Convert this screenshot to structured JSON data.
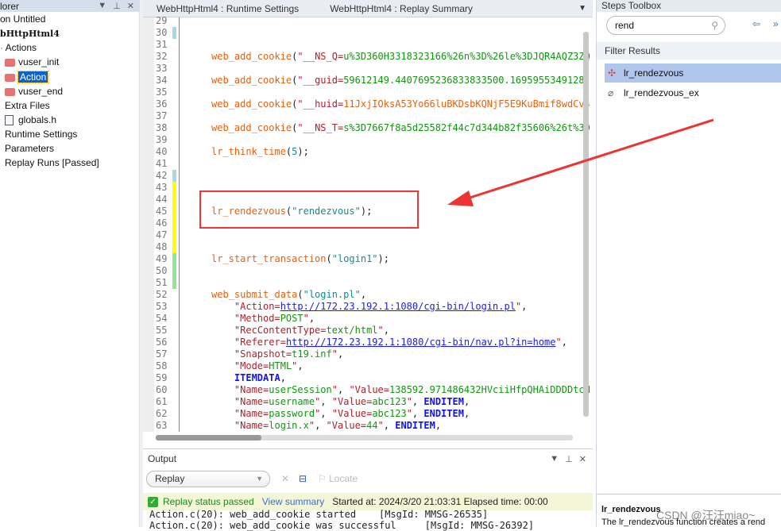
{
  "explorer": {
    "title": "lorer",
    "items": [
      "on Untitled",
      "bHttpHtml4",
      "Actions",
      "vuser_init",
      "Action",
      "vuser_end",
      "Extra Files",
      "globals.h",
      "Runtime Settings",
      "Parameters",
      "Replay Runs [Passed]"
    ]
  },
  "editor": {
    "tabs": [
      "WebHttpHtml4 : Runtime Settings",
      "WebHttpHtml4 : Replay Summary"
    ],
    "markers": {
      "30": "#a8d8e6",
      "42": "#a8d8e6",
      "43": "#ffff00",
      "44": "#ffff00",
      "45": "#ffff00",
      "46": "#ffff00",
      "47": "#ffff00",
      "48": "#ffff00",
      "49": "#90e890",
      "50": "#90e890",
      "51": "#90e890"
    },
    "lines": [
      {
        "n": 29,
        "t": []
      },
      {
        "n": 30,
        "t": []
      },
      {
        "n": 31,
        "t": []
      },
      {
        "n": 32,
        "t": [
          [
            "fn",
            "web_add_cookie"
          ],
          [
            "p",
            "("
          ],
          [
            "s",
            "\"__NS_Q="
          ],
          [
            "v",
            "u%3D360H3318323166%26n%3D%26le%3DJQR4AQZ3ZQ"
          ]
        ]
      },
      {
        "n": 33,
        "t": []
      },
      {
        "n": 34,
        "t": [
          [
            "fn",
            "web_add_cookie"
          ],
          [
            "p",
            "("
          ],
          [
            "s",
            "\"__guid="
          ],
          [
            "v",
            "59612149.4407695236833833500.1695955349128."
          ]
        ]
      },
      {
        "n": 35,
        "t": []
      },
      {
        "n": 36,
        "t": [
          [
            "fn",
            "web_add_cookie"
          ],
          [
            "p",
            "("
          ],
          [
            "s",
            "\"__huid="
          ],
          [
            "fn",
            "11JxjIOksA53Yo66luBKDsbKQNjF5E9KuBmif8wdCv4"
          ]
        ]
      },
      {
        "n": 37,
        "t": []
      },
      {
        "n": 38,
        "t": [
          [
            "fn",
            "web_add_cookie"
          ],
          [
            "p",
            "("
          ],
          [
            "s",
            "\"__NS_T="
          ],
          [
            "v",
            "s%3D7667f8a5d25582f44c7d344b82f35606%26t%3D"
          ]
        ]
      },
      {
        "n": 39,
        "t": []
      },
      {
        "n": 40,
        "t": [
          [
            "fn",
            "lr_think_time"
          ],
          [
            "p",
            "("
          ],
          [
            "n",
            "5"
          ],
          [
            "p",
            ");"
          ]
        ]
      },
      {
        "n": 41,
        "t": []
      },
      {
        "n": 42,
        "t": []
      },
      {
        "n": 43,
        "t": []
      },
      {
        "n": 44,
        "t": []
      },
      {
        "n": 45,
        "t": [
          [
            "fn",
            "lr_rendezvous"
          ],
          [
            "p",
            "("
          ],
          [
            "q",
            "\"rendezvous\""
          ],
          [
            "p",
            ");"
          ]
        ]
      },
      {
        "n": 46,
        "t": []
      },
      {
        "n": 47,
        "t": []
      },
      {
        "n": 48,
        "t": []
      },
      {
        "n": 49,
        "t": [
          [
            "fn",
            "lr_start_transaction"
          ],
          [
            "p",
            "("
          ],
          [
            "q",
            "\"login1\""
          ],
          [
            "p",
            ");"
          ]
        ]
      },
      {
        "n": 50,
        "t": []
      },
      {
        "n": 51,
        "t": []
      },
      {
        "n": 52,
        "t": [
          [
            "fn",
            "web_submit_data"
          ],
          [
            "p",
            "("
          ],
          [
            "q",
            "\"login.pl\""
          ],
          [
            "p",
            ","
          ]
        ]
      },
      {
        "n": 53,
        "t": [
          [
            "p",
            "    "
          ],
          [
            "s",
            "\"Action="
          ],
          [
            "lnk",
            "http://172.23.192.1:1080/cgi-bin/login.pl"
          ],
          [
            "s",
            "\""
          ],
          [
            "p",
            ","
          ]
        ]
      },
      {
        "n": 54,
        "t": [
          [
            "p",
            "    "
          ],
          [
            "s",
            "\"Method="
          ],
          [
            "v",
            "POST"
          ],
          [
            "s",
            "\""
          ],
          [
            "p",
            ","
          ]
        ]
      },
      {
        "n": 55,
        "t": [
          [
            "p",
            "    "
          ],
          [
            "s",
            "\"RecContentType="
          ],
          [
            "v",
            "text/html"
          ],
          [
            "s",
            "\""
          ],
          [
            "p",
            ","
          ]
        ]
      },
      {
        "n": 56,
        "t": [
          [
            "p",
            "    "
          ],
          [
            "s",
            "\"Referer="
          ],
          [
            "lnk",
            "http://172.23.192.1:1080/cgi-bin/nav.pl?in=home"
          ],
          [
            "s",
            "\""
          ],
          [
            "p",
            ","
          ]
        ]
      },
      {
        "n": 57,
        "t": [
          [
            "p",
            "    "
          ],
          [
            "s",
            "\"Snapshot="
          ],
          [
            "v",
            "t19.inf"
          ],
          [
            "s",
            "\""
          ],
          [
            "p",
            ","
          ]
        ]
      },
      {
        "n": 58,
        "t": [
          [
            "p",
            "    "
          ],
          [
            "s",
            "\"Mode="
          ],
          [
            "v",
            "HTML"
          ],
          [
            "s",
            "\""
          ],
          [
            "p",
            ","
          ]
        ]
      },
      {
        "n": 59,
        "t": [
          [
            "p",
            "    "
          ],
          [
            "kw",
            "ITEMDATA"
          ],
          [
            "p",
            ","
          ]
        ]
      },
      {
        "n": 60,
        "t": [
          [
            "p",
            "    "
          ],
          [
            "s",
            "\"Name="
          ],
          [
            "v",
            "userSession"
          ],
          [
            "s",
            "\""
          ],
          [
            "p",
            ", "
          ],
          [
            "s",
            "\"Value="
          ],
          [
            "v",
            "138592.971486432HVciiHfpQHAiDDDDtcH"
          ]
        ]
      },
      {
        "n": 61,
        "t": [
          [
            "p",
            "    "
          ],
          [
            "s",
            "\"Name="
          ],
          [
            "v",
            "username"
          ],
          [
            "s",
            "\""
          ],
          [
            "p",
            ", "
          ],
          [
            "s",
            "\"Value="
          ],
          [
            "v",
            "abc123"
          ],
          [
            "s",
            "\""
          ],
          [
            "p",
            ", "
          ],
          [
            "kw",
            "ENDITEM"
          ],
          [
            "p",
            ","
          ]
        ]
      },
      {
        "n": 62,
        "t": [
          [
            "p",
            "    "
          ],
          [
            "s",
            "\"Name="
          ],
          [
            "v",
            "password"
          ],
          [
            "s",
            "\""
          ],
          [
            "p",
            ", "
          ],
          [
            "s",
            "\"Value="
          ],
          [
            "v",
            "abc123"
          ],
          [
            "s",
            "\""
          ],
          [
            "p",
            ", "
          ],
          [
            "kw",
            "ENDITEM"
          ],
          [
            "p",
            ","
          ]
        ]
      },
      {
        "n": 63,
        "t": [
          [
            "p",
            "    "
          ],
          [
            "s",
            "\"Name="
          ],
          [
            "v",
            "login.x"
          ],
          [
            "s",
            "\""
          ],
          [
            "p",
            ", "
          ],
          [
            "s",
            "\"Value="
          ],
          [
            "v",
            "44"
          ],
          [
            "s",
            "\""
          ],
          [
            "p",
            ", "
          ],
          [
            "kw",
            "ENDITEM"
          ],
          [
            "p",
            ","
          ]
        ]
      }
    ]
  },
  "output": {
    "title": "Output",
    "source": "Replay",
    "locate": "Locate",
    "status": "Replay status passed",
    "view_summary": "View summary",
    "started": "Started at: 2024/3/20 21:03:31 Elapsed time: 00:00",
    "lines": [
      "Action.c(20): web_add_cookie started    [MsgId: MMSG-26535]",
      "Action.c(20): web_add_cookie was successful     [MsgId: MMSG-26392]"
    ]
  },
  "steps": {
    "title": "Steps Toolbox",
    "search": "rend",
    "filter_header": "Filter Results",
    "results": [
      "lr_rendezvous",
      "lr_rendezvous_ex"
    ],
    "help_title": "lr_rendezvous",
    "help_text": "The lr_rendezvous function creates a rend"
  },
  "watermark": "CSDN @汪汪miao~",
  "annotation_color": "#ee3333"
}
